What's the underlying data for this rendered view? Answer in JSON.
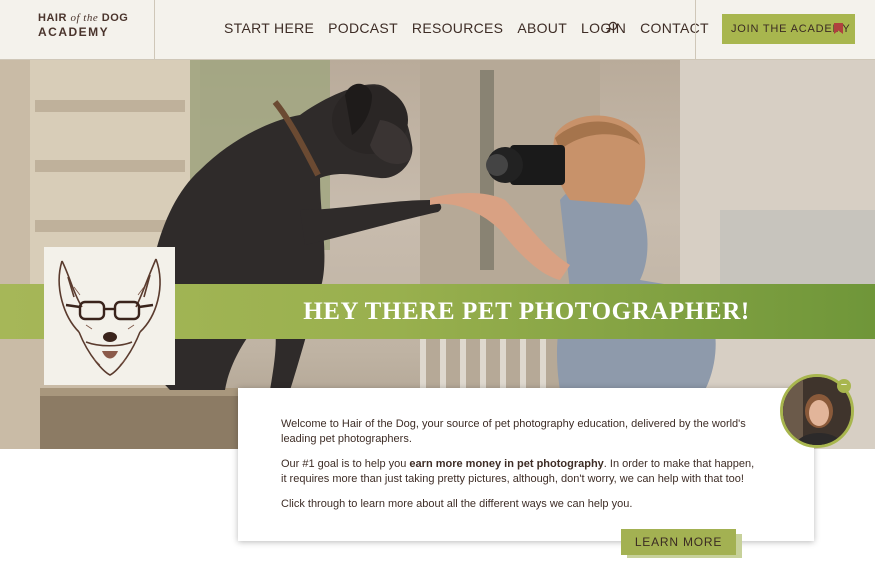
{
  "header": {
    "logo": {
      "line1_left": "HAIR",
      "line1_mid": "of the",
      "line1_right": "DOG",
      "line2": "ACADEMY"
    },
    "nav": [
      "START HERE",
      "PODCAST",
      "RESOURCES",
      "ABOUT",
      "LOGIN",
      "CONTACT"
    ],
    "cta_label": "JOIN THE ACADEMY"
  },
  "hero": {
    "title": "HEY THERE PET PHOTOGRAPHER!"
  },
  "content": {
    "p1": "Welcome to Hair of the Dog, your source of pet photography education, delivered by the world's leading pet photographers.",
    "p2_before": "Our #1 goal is to help you ",
    "p2_bold": "earn more money in pet photography",
    "p2_after": ".  In order to make that happen, it requires more than just taking pretty pictures, although, don't worry, we can help with that too!",
    "p3": "Click through to learn more about all the different ways we can help you.",
    "button_label": "LEARN MORE"
  },
  "chat": {
    "close_symbol": "−"
  },
  "colors": {
    "accent_green": "#a8b64e",
    "banner_dark_green": "#6f9639",
    "brand_brown": "#4a342c",
    "header_bg": "#f4f2ec"
  },
  "icons": [
    "search-icon",
    "bookmark-icon",
    "corgi-illustration",
    "chat-avatar"
  ]
}
